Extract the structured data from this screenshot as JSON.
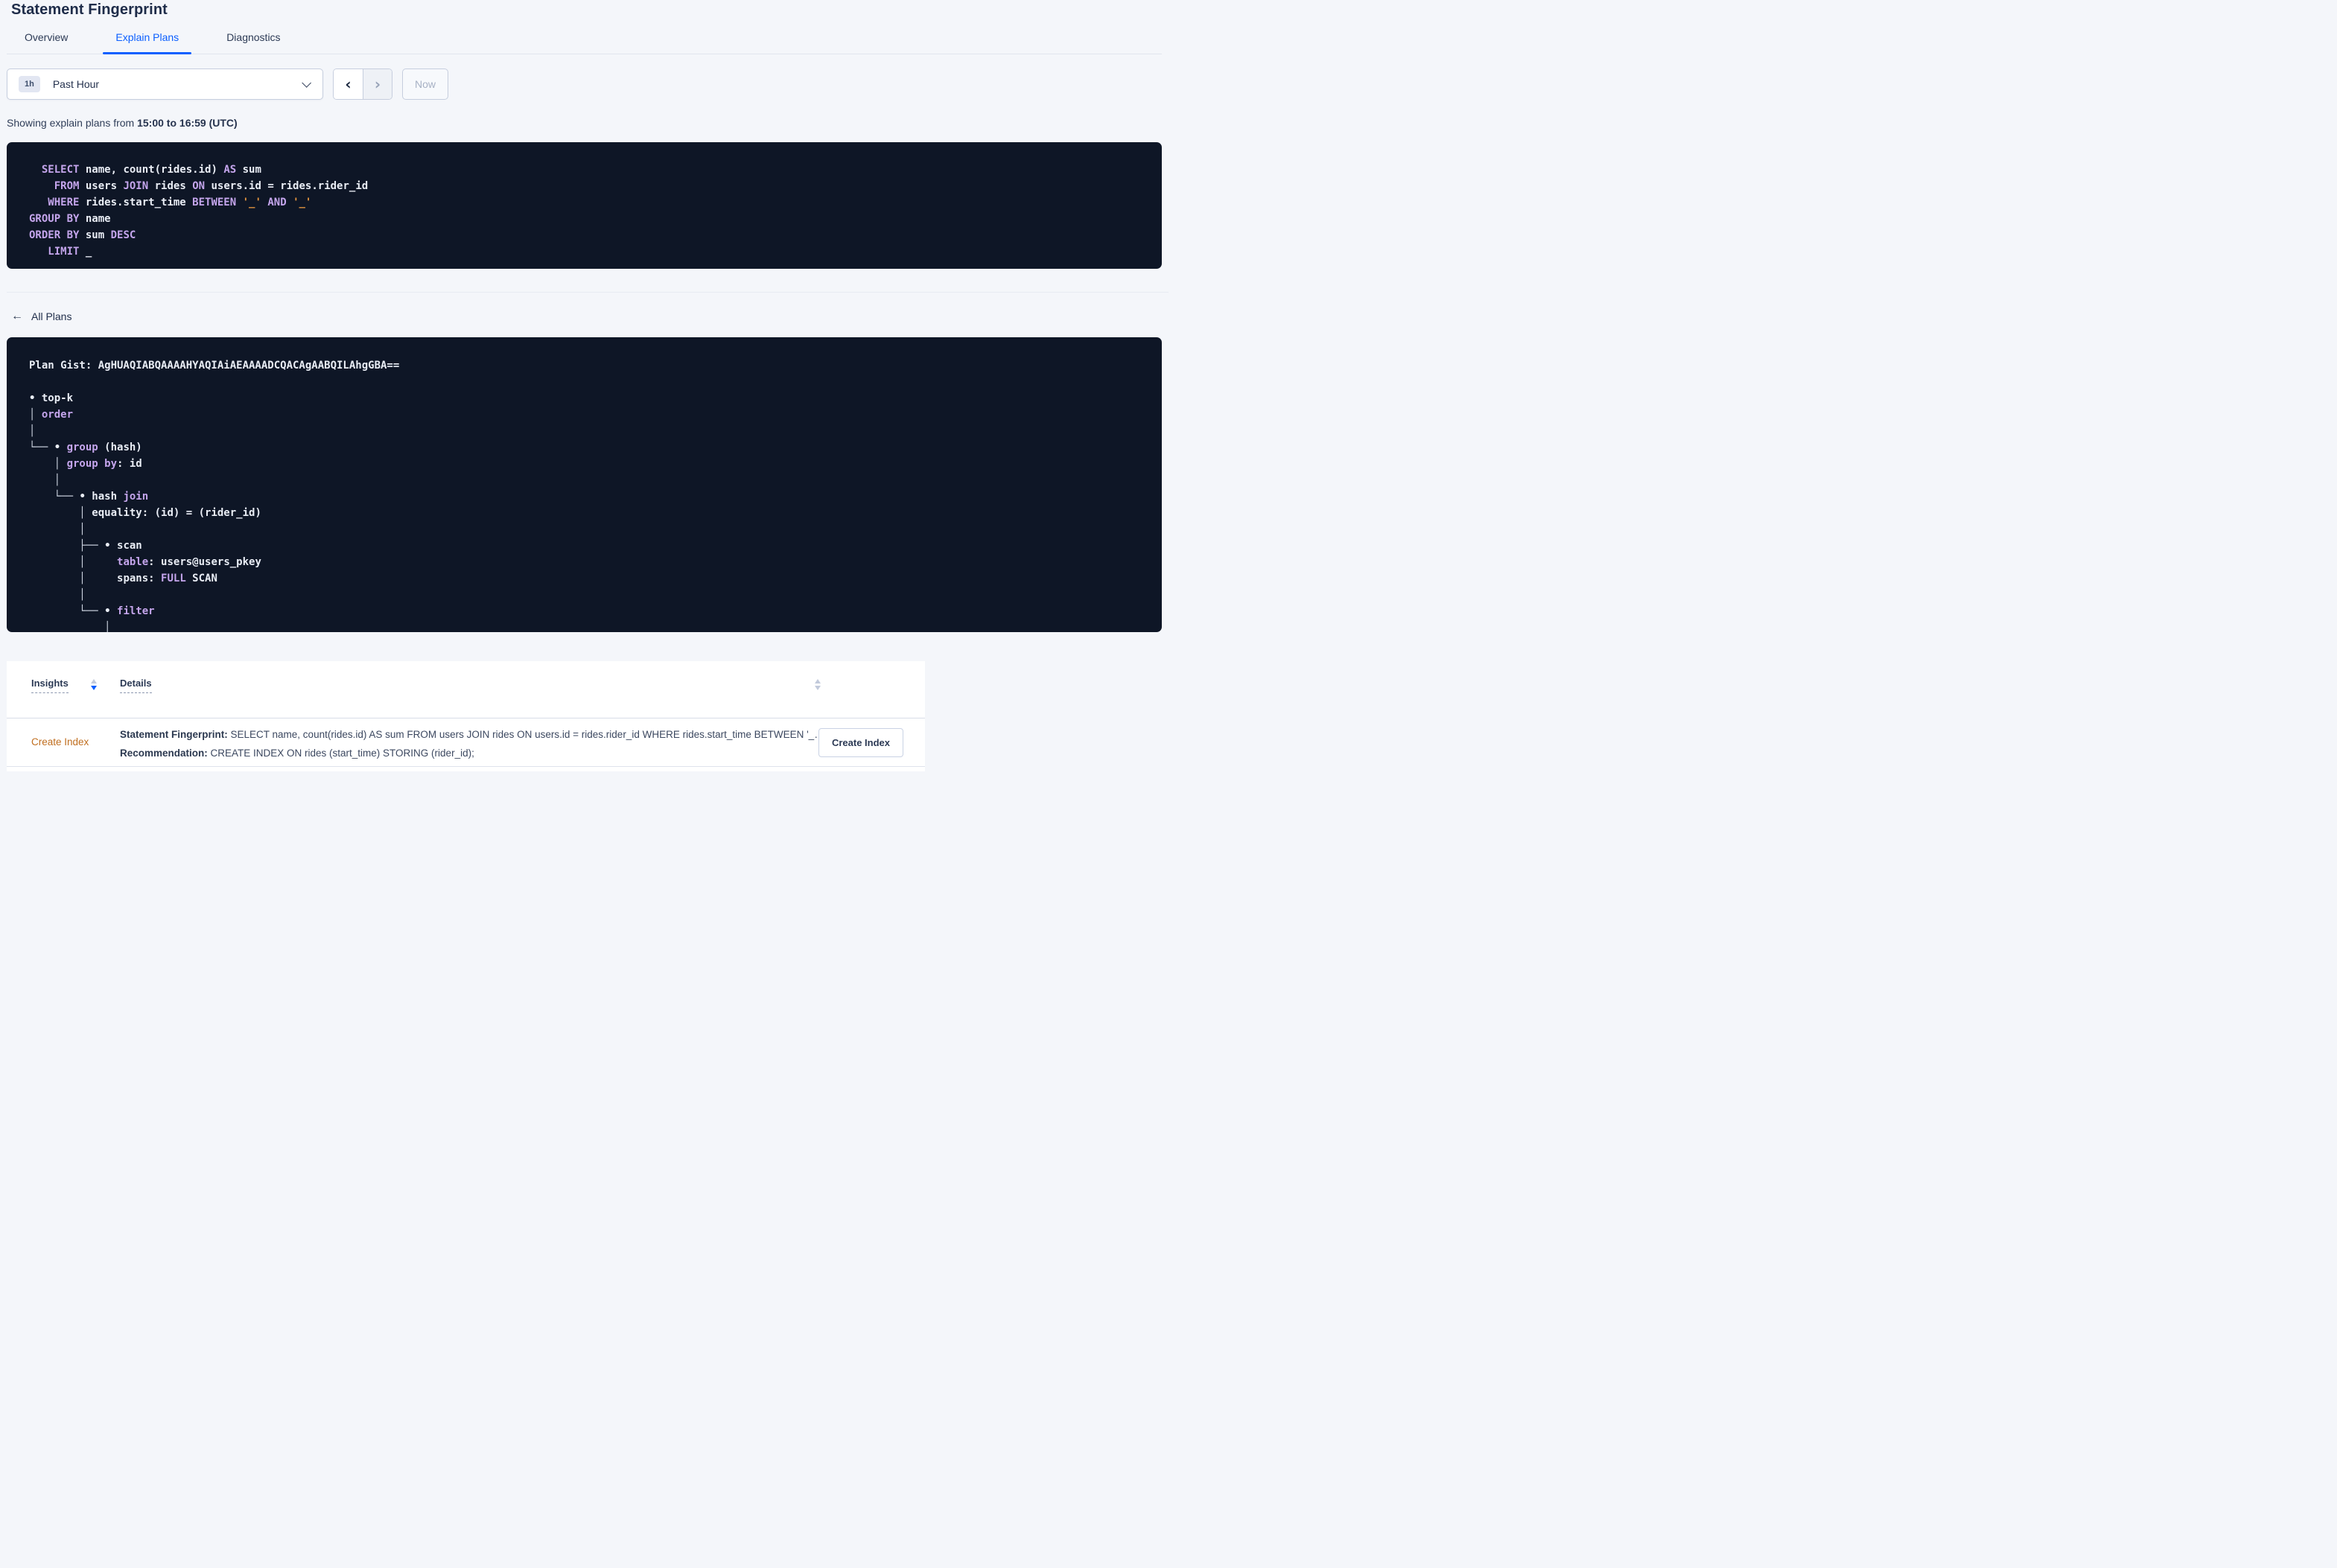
{
  "page": {
    "title": "Statement Fingerprint"
  },
  "tabs": [
    {
      "label": "Overview",
      "active": false
    },
    {
      "label": "Explain Plans",
      "active": true
    },
    {
      "label": "Diagnostics",
      "active": false
    }
  ],
  "time_picker": {
    "badge": "1h",
    "label": "Past Hour",
    "now_label": "Now"
  },
  "showing": {
    "prefix": "Showing explain plans from ",
    "range": "15:00 to 16:59 (UTC)"
  },
  "all_plans": {
    "label": "All Plans"
  },
  "colors": {
    "accent_blue": "#0b5fff",
    "code_background": "#0e1626",
    "code_keyword_purple": "#c4a5ec",
    "code_literal_orange": "#e6963f",
    "insight_orange": "#c06e1f"
  },
  "sql_block": {
    "lines": [
      [
        [
          "k",
          "  SELECT"
        ],
        [
          "w",
          " name, count(rides.id) "
        ],
        [
          "k",
          "AS"
        ],
        [
          "w",
          " sum"
        ]
      ],
      [
        [
          "k",
          "    FROM"
        ],
        [
          "w",
          " users "
        ],
        [
          "k",
          "JOIN"
        ],
        [
          "w",
          " rides "
        ],
        [
          "k",
          "ON"
        ],
        [
          "w",
          " users.id = rides.rider_id"
        ]
      ],
      [
        [
          "k",
          "   WHERE"
        ],
        [
          "w",
          " rides.start_time "
        ],
        [
          "k",
          "BETWEEN"
        ],
        [
          "w",
          " "
        ],
        [
          "o",
          "'_'"
        ],
        [
          "w",
          " "
        ],
        [
          "k",
          "AND"
        ],
        [
          "w",
          " "
        ],
        [
          "o",
          "'_'"
        ]
      ],
      [
        [
          "k",
          "GROUP BY"
        ],
        [
          "w",
          " name"
        ]
      ],
      [
        [
          "k",
          "ORDER BY"
        ],
        [
          "w",
          " sum "
        ],
        [
          "k",
          "DESC"
        ]
      ],
      [
        [
          "k",
          "   LIMIT"
        ],
        [
          "w",
          " _"
        ]
      ]
    ]
  },
  "gist_block": {
    "lines": [
      [
        [
          "bw",
          "Plan Gist: AgHUAQIABQAAAAHYAQIAiAEAAAADCQACAgAABQILAhgGBA=="
        ]
      ],
      [],
      [
        [
          "w",
          "• top-k"
        ]
      ],
      [
        [
          "t",
          "│ "
        ],
        [
          "k",
          "order"
        ]
      ],
      [
        [
          "t",
          "│"
        ]
      ],
      [
        [
          "t",
          "└── "
        ],
        [
          "w",
          "• "
        ],
        [
          "k",
          "group"
        ],
        [
          "w",
          " (hash)"
        ]
      ],
      [
        [
          "t",
          "    │ "
        ],
        [
          "k",
          "group by"
        ],
        [
          "w",
          ": id"
        ]
      ],
      [
        [
          "t",
          "    │"
        ]
      ],
      [
        [
          "t",
          "    └── "
        ],
        [
          "w",
          "• hash "
        ],
        [
          "k",
          "join"
        ]
      ],
      [
        [
          "t",
          "        │ "
        ],
        [
          "w",
          "equality: (id) = (rider_id)"
        ]
      ],
      [
        [
          "t",
          "        │"
        ]
      ],
      [
        [
          "t",
          "        ├── "
        ],
        [
          "w",
          "• scan"
        ]
      ],
      [
        [
          "t",
          "        │     "
        ],
        [
          "k",
          "table"
        ],
        [
          "w",
          ": users@users_pkey"
        ]
      ],
      [
        [
          "t",
          "        │     "
        ],
        [
          "w",
          "spans: "
        ],
        [
          "k",
          "FULL"
        ],
        [
          "w",
          " SCAN"
        ]
      ],
      [
        [
          "t",
          "        │"
        ]
      ],
      [
        [
          "t",
          "        └── "
        ],
        [
          "w",
          "• "
        ],
        [
          "k",
          "filter"
        ]
      ],
      [
        [
          "t",
          "            │"
        ]
      ]
    ]
  },
  "insights_table": {
    "columns": [
      {
        "label": "Insights",
        "sort": "desc"
      },
      {
        "label": "Details",
        "sort": "none"
      }
    ],
    "rows": [
      {
        "insight": "Create Index",
        "details": [
          {
            "label": "Statement Fingerprint:",
            "text": " SELECT name, count(rides.id) AS sum FROM users JOIN rides ON users.id = rides.rider_id WHERE rides.start_time BETWEEN '_…"
          },
          {
            "label": "Recommendation:",
            "text": " CREATE INDEX ON rides (start_time) STORING (rider_id);"
          }
        ],
        "action": "Create Index"
      }
    ]
  }
}
